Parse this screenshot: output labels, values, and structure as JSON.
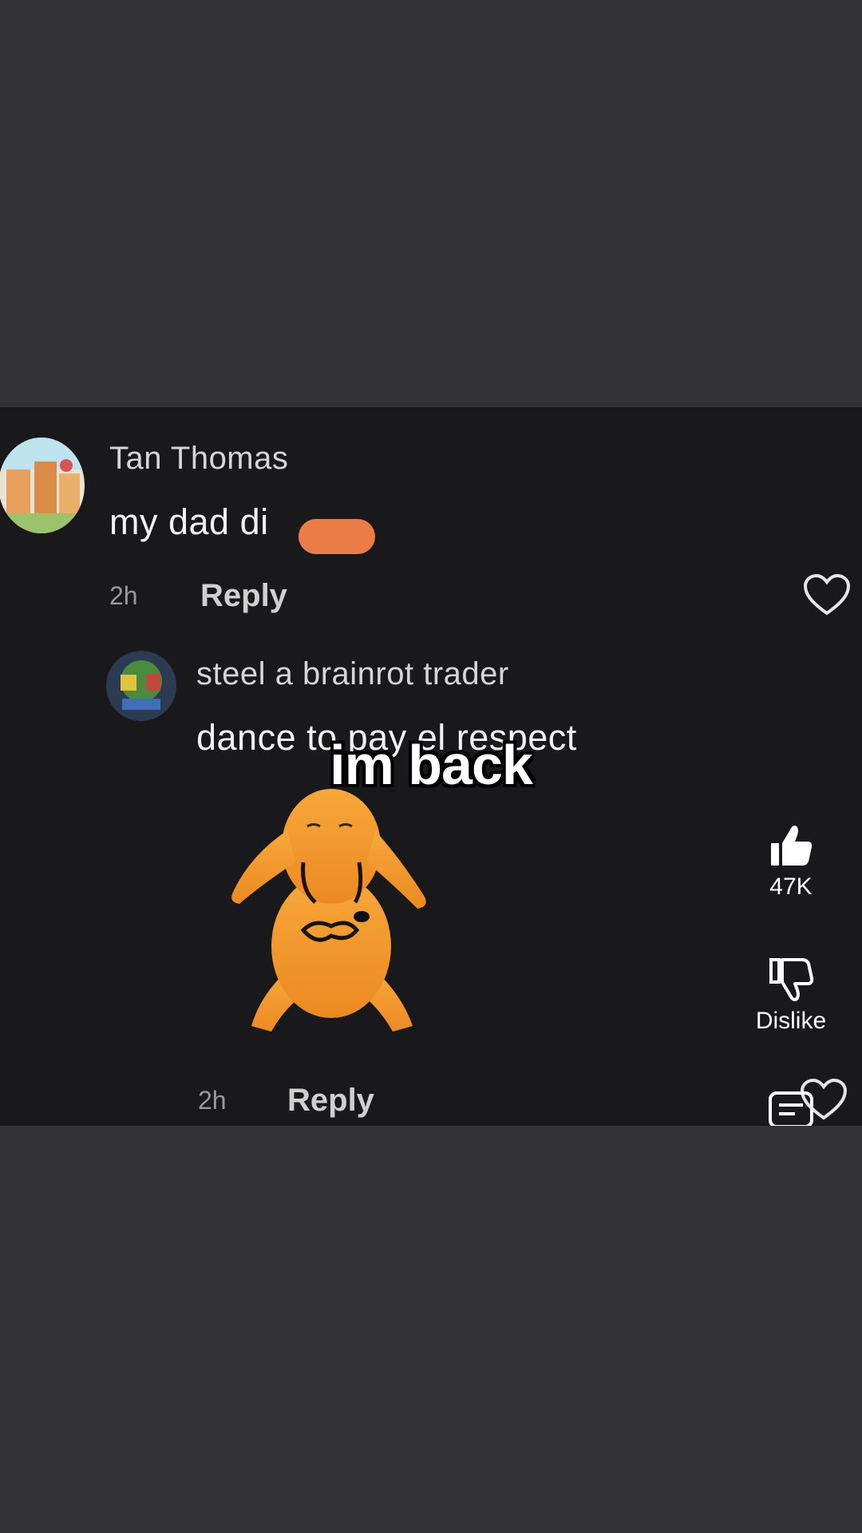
{
  "comments": [
    {
      "author": "Tan Thomas",
      "text": "my dad di",
      "time": "2h",
      "reply_label": "Reply"
    },
    {
      "author": "steel a brainrot trader",
      "text": "dance to pay el respect",
      "time": "2h",
      "reply_label": "Reply"
    }
  ],
  "caption": "im back",
  "actions": {
    "like_count": "47K",
    "dislike_label": "Dislike"
  },
  "icons": {
    "like": "thumbs-up-icon",
    "dislike": "thumbs-down-icon",
    "comments": "comments-icon",
    "comment_like": "heart-icon"
  },
  "colors": {
    "background": "#333335",
    "video_background": "#19191b",
    "redaction_blob": "#ec7c47",
    "dog": "#f4a130"
  }
}
